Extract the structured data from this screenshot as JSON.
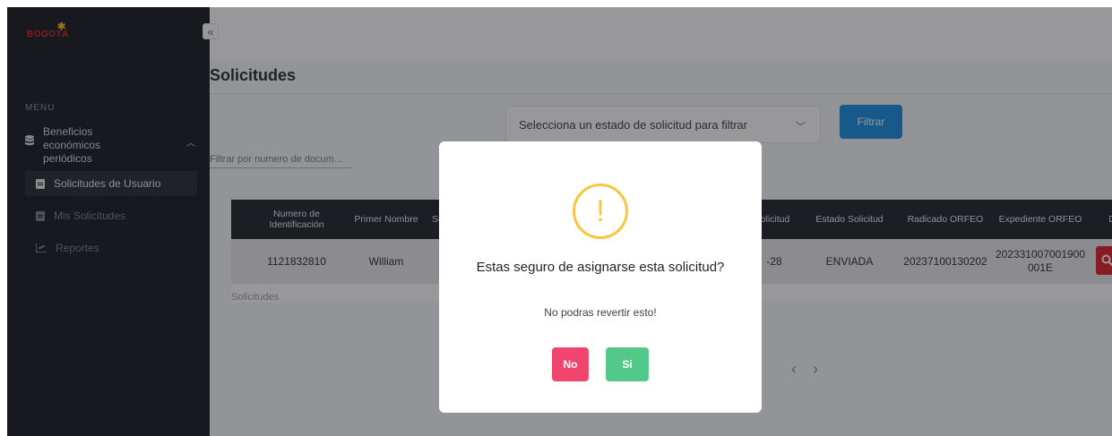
{
  "sidebar": {
    "logo": "BOGOTÁ",
    "menu_label": "MENU",
    "group": {
      "label": "Beneficios económicos periódicos"
    },
    "items": [
      {
        "label": "Solicitudes de Usuario",
        "icon": "document-icon",
        "active": true
      },
      {
        "label": "Mis Solicitudes",
        "icon": "document-icon",
        "active": false
      },
      {
        "label": "Reportes",
        "icon": "chart-icon",
        "active": false
      }
    ]
  },
  "main": {
    "title": "Solicitudes",
    "status_select": {
      "placeholder": "Selecciona un estado de solicitud para filtrar"
    },
    "filter_button": "Filtrar",
    "doc_filter_placeholder": "Filtrar por numero de docum...",
    "table": {
      "headers": [
        "Numero de Identificación",
        "Primer Nombre",
        "Se",
        "olicitud",
        "Estado Solicitud",
        "Radicado ORFEO",
        "Expediente ORFEO",
        "D"
      ],
      "row": {
        "id": "1121832810",
        "name": "William",
        "date_fragment": "-28",
        "status": "ENVIADA",
        "radicado": "20237100130202",
        "expediente": "202331007001900001E"
      },
      "caption": "Solicitudes"
    }
  },
  "modal": {
    "title": "Estas seguro de asignarse esta solicitud?",
    "text": "No podras revertir esto!",
    "no_button": "No",
    "yes_button": "Si"
  },
  "colors": {
    "sidebar_bg": "#1c1d22",
    "primary": "#1a8fe3",
    "warning": "#f8c63d",
    "danger": "#f0456e",
    "success": "#52c988",
    "search_red": "#e0232f"
  }
}
